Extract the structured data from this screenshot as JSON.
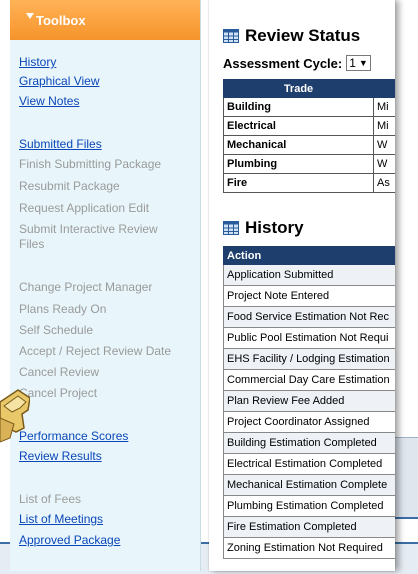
{
  "toolbox": {
    "title": "Toolbox",
    "items": [
      {
        "label": "History",
        "type": "link"
      },
      {
        "label": "Graphical View",
        "type": "link"
      },
      {
        "label": "View Notes",
        "type": "link"
      },
      {
        "label": "Submitted Files",
        "type": "link"
      },
      {
        "label": "Finish Submitting Package",
        "type": "disabled"
      },
      {
        "label": "Resubmit Package",
        "type": "disabled"
      },
      {
        "label": "Request Application Edit",
        "type": "disabled"
      },
      {
        "label": "Submit Interactive Review",
        "type": "disabled"
      },
      {
        "label": "Files",
        "type": "disabled"
      },
      {
        "label": "Change Project Manager",
        "type": "disabled"
      },
      {
        "label": "Plans Ready On",
        "type": "disabled"
      },
      {
        "label": "Self Schedule",
        "type": "disabled"
      },
      {
        "label": "Accept / Reject Review Date",
        "type": "disabled"
      },
      {
        "label": "Cancel Review",
        "type": "disabled"
      },
      {
        "label": "Cancel Project",
        "type": "disabled"
      },
      {
        "label": "Performance Scores",
        "type": "link"
      },
      {
        "label": "Review Results",
        "type": "link"
      },
      {
        "label": "List of Fees",
        "type": "disabled"
      },
      {
        "label": "List of Meetings",
        "type": "link"
      },
      {
        "label": "Approved Package",
        "type": "link"
      }
    ]
  },
  "review_status": {
    "title": "Review Status",
    "cycle_label": "Assessment Cycle:",
    "cycle_value": "1",
    "header": "Trade",
    "rows": [
      {
        "trade": "Building",
        "status": "Mi"
      },
      {
        "trade": "Electrical",
        "status": "Mi"
      },
      {
        "trade": "Mechanical",
        "status": "W"
      },
      {
        "trade": "Plumbing",
        "status": "W"
      },
      {
        "trade": "Fire",
        "status": "As"
      }
    ]
  },
  "history": {
    "title": "History",
    "header": "Action",
    "rows": [
      "Application Submitted",
      "Project Note Entered",
      "Food Service Estimation Not Rec",
      "Public Pool Estimation Not Requi",
      "EHS Facility / Lodging Estimation",
      "Commercial Day Care Estimation",
      "Plan Review Fee Added",
      "Project Coordinator Assigned",
      "Building Estimation Completed",
      "Electrical Estimation Completed",
      "Mechanical Estimation Complete",
      "Plumbing Estimation Completed",
      "Fire Estimation Completed",
      "Zoning Estimation Not Required"
    ]
  },
  "colors": {
    "toolbox_bg": "#e8f6fb",
    "toolbox_header": "#f6942b",
    "link": "#0b47b8",
    "disabled": "#9a9a9a",
    "table_header": "#1e3f6e"
  }
}
